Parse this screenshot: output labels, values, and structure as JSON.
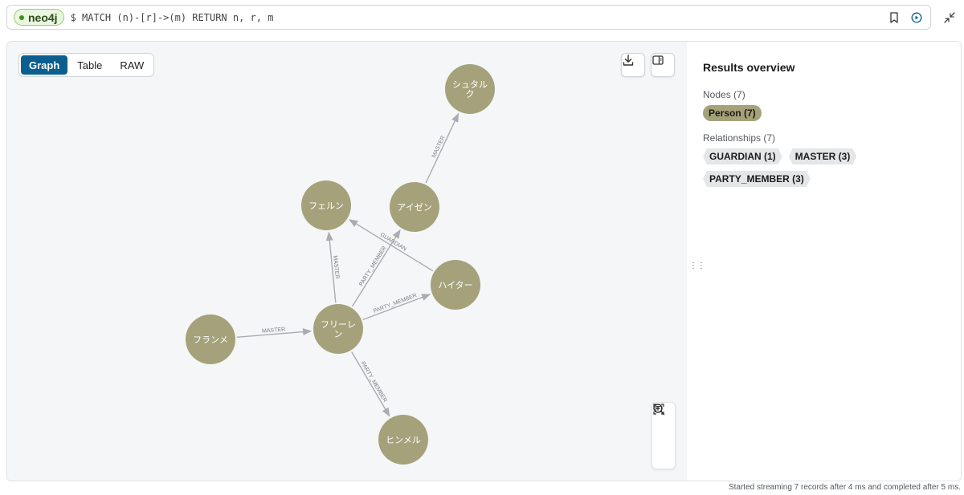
{
  "query_bar": {
    "db_name": "neo4j",
    "query": "$ MATCH (n)-[r]->(m) RETURN n, r, m",
    "icons": [
      "bookmark-icon",
      "run-icon",
      "minimize-icon"
    ]
  },
  "view_toggle": {
    "options": [
      "Graph",
      "Table",
      "RAW"
    ],
    "selected": "Graph"
  },
  "graph": {
    "node_color": "#a5a27b",
    "edge_color": "#a9acb0",
    "nodes": [
      {
        "id": "stark",
        "label_lines": [
          "シュタル",
          "ク"
        ]
      },
      {
        "id": "fern",
        "label_lines": [
          "フェルン"
        ]
      },
      {
        "id": "eisen",
        "label_lines": [
          "アイゼン"
        ]
      },
      {
        "id": "heiter",
        "label_lines": [
          "ハイター"
        ]
      },
      {
        "id": "flamme",
        "label_lines": [
          "フランメ"
        ]
      },
      {
        "id": "frieren",
        "label_lines": [
          "フリーレ",
          "ン"
        ]
      },
      {
        "id": "himmel",
        "label_lines": [
          "ヒンメル"
        ]
      }
    ],
    "edges": [
      {
        "from": "eisen",
        "to": "stark",
        "type": "MASTER"
      },
      {
        "from": "frieren",
        "to": "fern",
        "type": "MASTER"
      },
      {
        "from": "heiter",
        "to": "fern",
        "type": "GUARDIAN"
      },
      {
        "from": "frieren",
        "to": "eisen",
        "type": "PARTY_MEMBER"
      },
      {
        "from": "frieren",
        "to": "heiter",
        "type": "PARTY_MEMBER"
      },
      {
        "from": "flamme",
        "to": "frieren",
        "type": "MASTER"
      },
      {
        "from": "frieren",
        "to": "himmel",
        "type": "PARTY_MEMBER"
      }
    ]
  },
  "panel": {
    "title": "Results overview",
    "nodes_label": "Nodes (7)",
    "node_chips": [
      "Person (7)"
    ],
    "relationships_label": "Relationships (7)",
    "relationship_chips": [
      "GUARDIAN (1)",
      "MASTER (3)",
      "PARTY_MEMBER (3)"
    ]
  },
  "status_text": "Started streaming 7 records after 4 ms and completed after 5 ms."
}
